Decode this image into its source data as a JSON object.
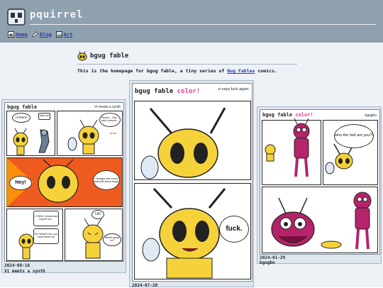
{
  "site": {
    "title": "pquirrel"
  },
  "nav": [
    {
      "label": "Home",
      "icon": "house-icon"
    },
    {
      "label": "Blog",
      "icon": "pen-icon"
    },
    {
      "label": "Art",
      "icon": "picture-icon"
    }
  ],
  "page": {
    "title": "bgug fable",
    "intro_prefix": "This is the homepage for bgug fable, a tiny series of ",
    "intro_link": "Bug Fables",
    "intro_suffix": " comics."
  },
  "comics": [
    {
      "strip_title": "bgug fable",
      "strip_subtitle": "Vi meets a synth",
      "bubble_hi": "Hi there!",
      "bubble_wait": "Wait huh",
      "bubble_hmm": "Hmmm... Hey... wait a second...",
      "bubble_ohno": "oh no",
      "bubble_hey": "Hey!",
      "bubble_thought": "I thought this comic was just about bugs!",
      "bubble_think": "I THINK I should see myself out...",
      "bubble_uh": "Uh!",
      "bubble_sowhat": "So! What'll it be, you know about me",
      "bubble_what": "What's going on?",
      "date": "2024-08-16",
      "caption": "Vi meets a synth"
    },
    {
      "strip_title_plain": "bgug fable ",
      "strip_title_color": "color!",
      "strip_subtitle": "vi says fuck again",
      "bubble": "fuck.",
      "date": "2024-07-20"
    },
    {
      "strip_title_plain": "bgug fable ",
      "strip_title_color": "color!",
      "strip_subtitle": "bgugbo",
      "bubble": "who the hell are you?!",
      "date": "2024-01-29",
      "caption": "bgugbo"
    }
  ],
  "colors": {
    "header": "#8fa0ae",
    "content_bg": "#eef1f6",
    "link": "#2a3ca8",
    "bee": "#f5d23a",
    "bug": "#b5246a"
  }
}
